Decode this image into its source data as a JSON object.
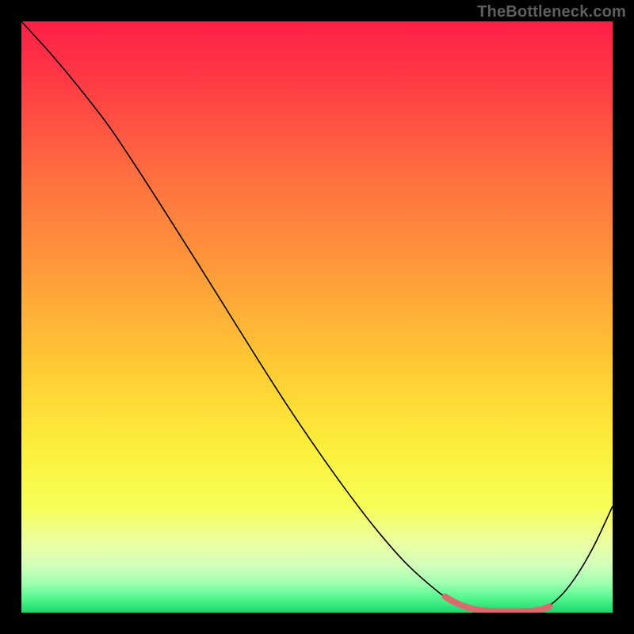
{
  "watermark": "TheBottleneck.com",
  "chart_data": {
    "type": "line",
    "title": "",
    "xlabel": "",
    "ylabel": "",
    "xlim": [
      0,
      100
    ],
    "ylim": [
      0,
      100
    ],
    "grid": false,
    "legend": false,
    "series": [
      {
        "name": "curve",
        "color": "#000000",
        "x": [
          0,
          5,
          10,
          15,
          20,
          25,
          30,
          35,
          40,
          45,
          50,
          55,
          60,
          65,
          70,
          73,
          76,
          79,
          82,
          85,
          88,
          91,
          94,
          97,
          100
        ],
        "y": [
          100,
          94.5,
          88.5,
          82.0,
          74.5,
          66.7,
          58.8,
          50.8,
          42.8,
          35.0,
          27.6,
          20.6,
          14.1,
          8.4,
          3.9,
          1.8,
          0.7,
          0.25,
          0.2,
          0.2,
          0.5,
          2.6,
          6.4,
          11.6,
          18.0
        ]
      },
      {
        "name": "optimal-marker",
        "color": "#d96a6d",
        "x": [
          71.5,
          73,
          74.5,
          76,
          77.5,
          79,
          80.5,
          82,
          83.5,
          85,
          86.5,
          88,
          89.5
        ],
        "y": [
          2.8,
          1.9,
          1.2,
          0.7,
          0.4,
          0.25,
          0.2,
          0.2,
          0.2,
          0.2,
          0.3,
          0.5,
          1.1
        ]
      }
    ],
    "background": {
      "type": "vertical-gradient",
      "stops": [
        {
          "pct": 0,
          "color": "#ff1f47"
        },
        {
          "pct": 10,
          "color": "#ff3a45"
        },
        {
          "pct": 25,
          "color": "#ff6b40"
        },
        {
          "pct": 42,
          "color": "#ff9a3a"
        },
        {
          "pct": 58,
          "color": "#ffc934"
        },
        {
          "pct": 72,
          "color": "#fcef3a"
        },
        {
          "pct": 82,
          "color": "#f6ff57"
        },
        {
          "pct": 88,
          "color": "#ecffa0"
        },
        {
          "pct": 92,
          "color": "#d2ffba"
        },
        {
          "pct": 95,
          "color": "#a0ffb0"
        },
        {
          "pct": 97.5,
          "color": "#55f78f"
        },
        {
          "pct": 100,
          "color": "#17d86a"
        }
      ]
    }
  }
}
